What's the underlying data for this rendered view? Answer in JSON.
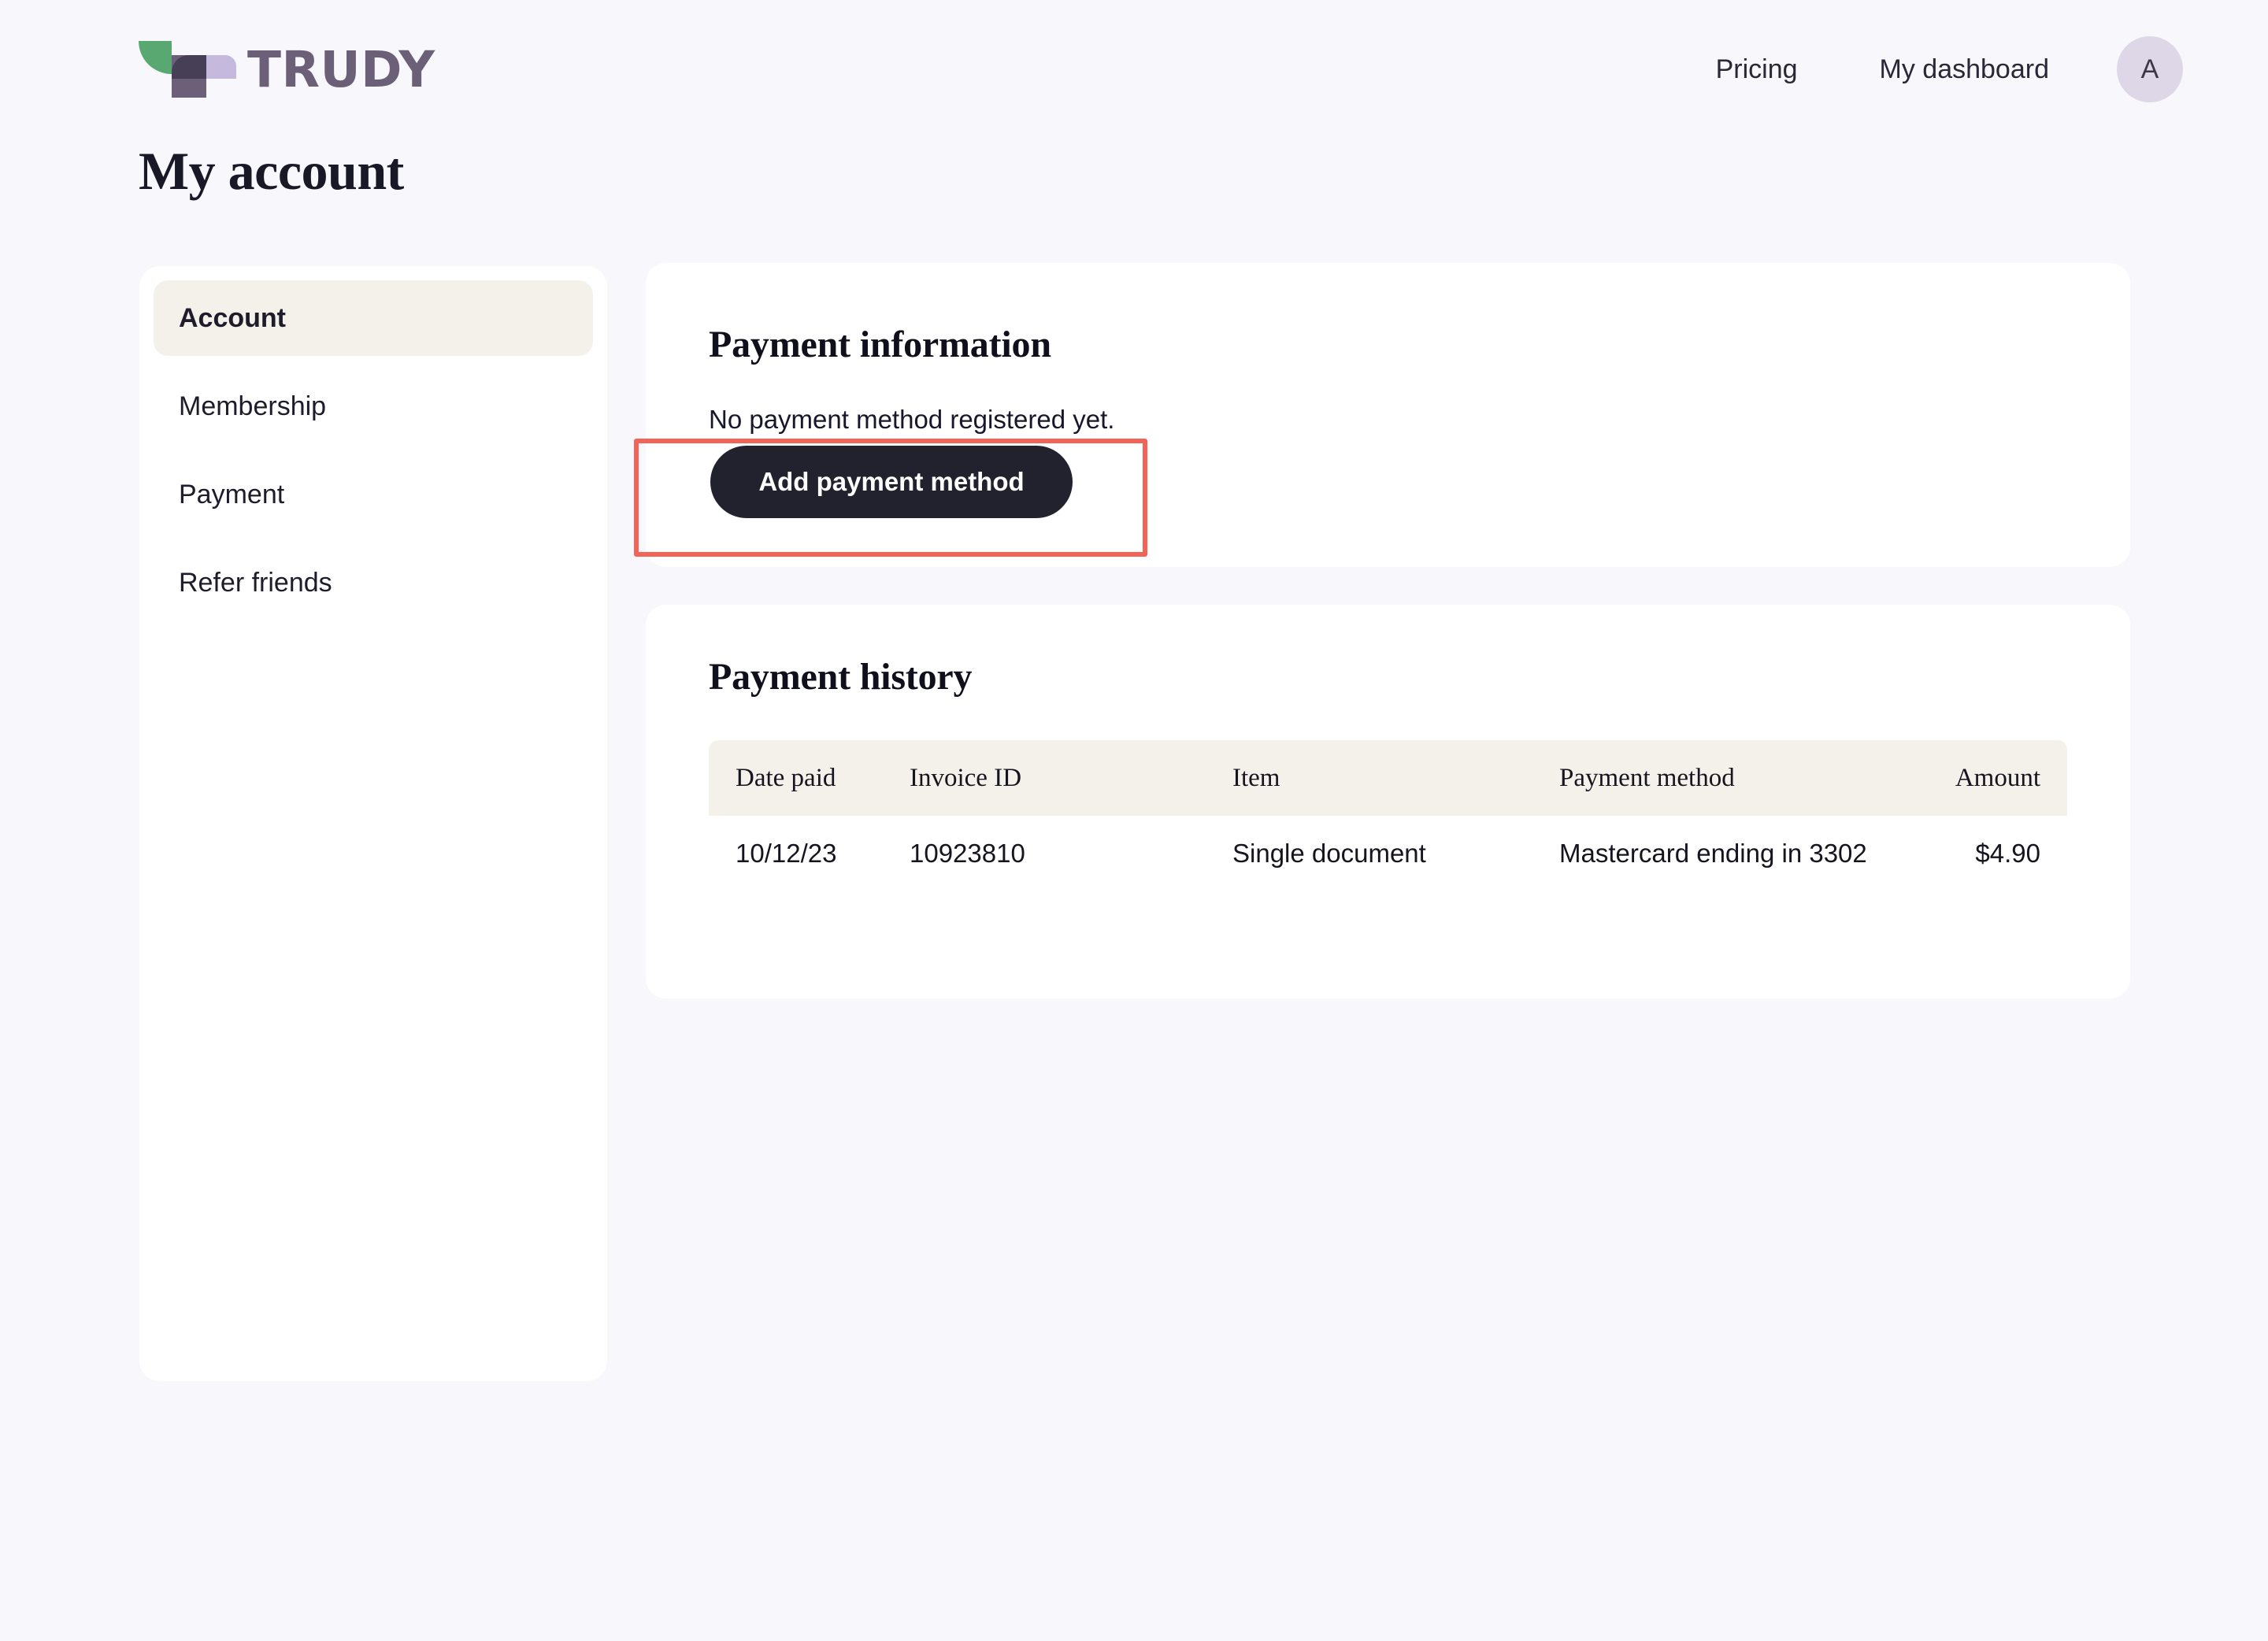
{
  "brand": {
    "name": "TRUDY",
    "colors": {
      "leaf_green": "#59a871",
      "t_dark": "#463f55",
      "t_light": "#c5b9dd",
      "wordmark": "#6b6077"
    }
  },
  "header": {
    "nav": [
      {
        "label": "Pricing"
      },
      {
        "label": "My dashboard"
      }
    ],
    "avatar_initial": "A"
  },
  "page": {
    "title": "My account"
  },
  "sidebar": {
    "items": [
      {
        "label": "Account",
        "active": true
      },
      {
        "label": "Membership",
        "active": false
      },
      {
        "label": "Payment",
        "active": false
      },
      {
        "label": "Refer friends",
        "active": false
      }
    ]
  },
  "payment_information": {
    "title": "Payment information",
    "empty_message": "No payment method registered yet.",
    "add_button_label": "Add payment method"
  },
  "payment_history": {
    "title": "Payment history",
    "columns": [
      "Date paid",
      "Invoice ID",
      "Item",
      "Payment method",
      "Amount"
    ],
    "rows": [
      {
        "date_paid": "10/12/23",
        "invoice_id": "10923810",
        "item": "Single document",
        "payment_method": "Mastercard ending in 3302",
        "amount": "$4.90"
      }
    ]
  },
  "annotation": {
    "color": "#f26457",
    "target": "Add payment method"
  }
}
